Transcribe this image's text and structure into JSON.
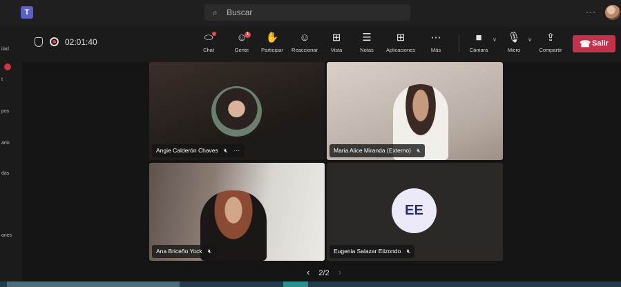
{
  "titlebar": {
    "app_logo": "T",
    "search_placeholder": "Buscar",
    "more": "···"
  },
  "rail": {
    "items": [
      "ilad",
      "t",
      "pos",
      "ario",
      "das",
      "ones"
    ]
  },
  "meeting": {
    "elapsed": "02:01:40"
  },
  "toolbar": {
    "chat": "Chat",
    "people": "Gente",
    "people_badge": "1",
    "raise_hand": "Participar",
    "react": "Reaccionar",
    "view": "Vista",
    "notes": "Notas",
    "apps": "Aplicaciones",
    "more": "Más",
    "camera": "Cámara",
    "mic": "Micro",
    "share": "Compartir",
    "leave": "Salir"
  },
  "participants": [
    {
      "name": "Angie Calderón Chaves"
    },
    {
      "name": "Maria Alice Miranda (Externo)"
    },
    {
      "name": "Ana Briceño Yock"
    },
    {
      "name": "Eugenia Salazar Elizondo",
      "initials": "EE"
    }
  ],
  "pager": {
    "label": "2/2"
  },
  "colors": {
    "leave": "#c4314b",
    "accent": "#5b5fc7",
    "background": "#141414"
  }
}
